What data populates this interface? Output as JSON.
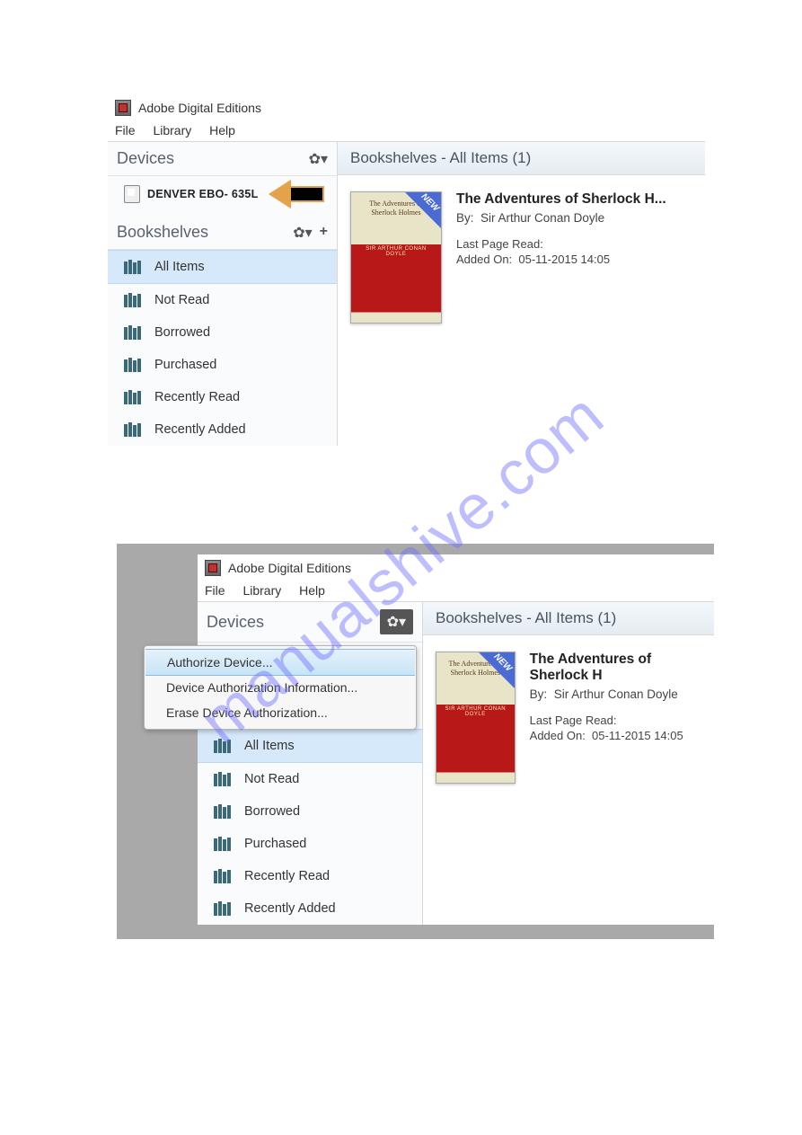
{
  "watermark": "manualshive.com",
  "app_title": "Adobe Digital Editions",
  "menu": {
    "file": "File",
    "library": "Library",
    "help": "Help"
  },
  "sidebar": {
    "devices_header": "Devices",
    "device_name": "DENVER EBO- 635L",
    "bookshelves_header": "Bookshelves",
    "items": [
      {
        "label": "All Items",
        "selected": true
      },
      {
        "label": "Not Read"
      },
      {
        "label": "Borrowed"
      },
      {
        "label": "Purchased"
      },
      {
        "label": "Recently Read"
      },
      {
        "label": "Recently Added"
      }
    ]
  },
  "main": {
    "header": "Bookshelves - All Items (1)",
    "book": {
      "title_display": "The Adventures of Sherlock H...",
      "title_display2": "The Adventures of Sherlock H",
      "author_label": "By:",
      "author": "Sir Arthur Conan Doyle",
      "last_page_label": "Last Page Read:",
      "added_label": "Added On:",
      "added_value": "05-11-2015 14:05",
      "new_label": "NEW",
      "cover_title": "The Adventures of Sherlock Holmes",
      "cover_author": "SIR ARTHUR CONAN DOYLE"
    }
  },
  "context_menu": {
    "items": [
      {
        "label": "Authorize Device...",
        "highlight": true
      },
      {
        "label": "Device Authorization Information..."
      },
      {
        "label": "Erase Device Authorization..."
      }
    ]
  }
}
